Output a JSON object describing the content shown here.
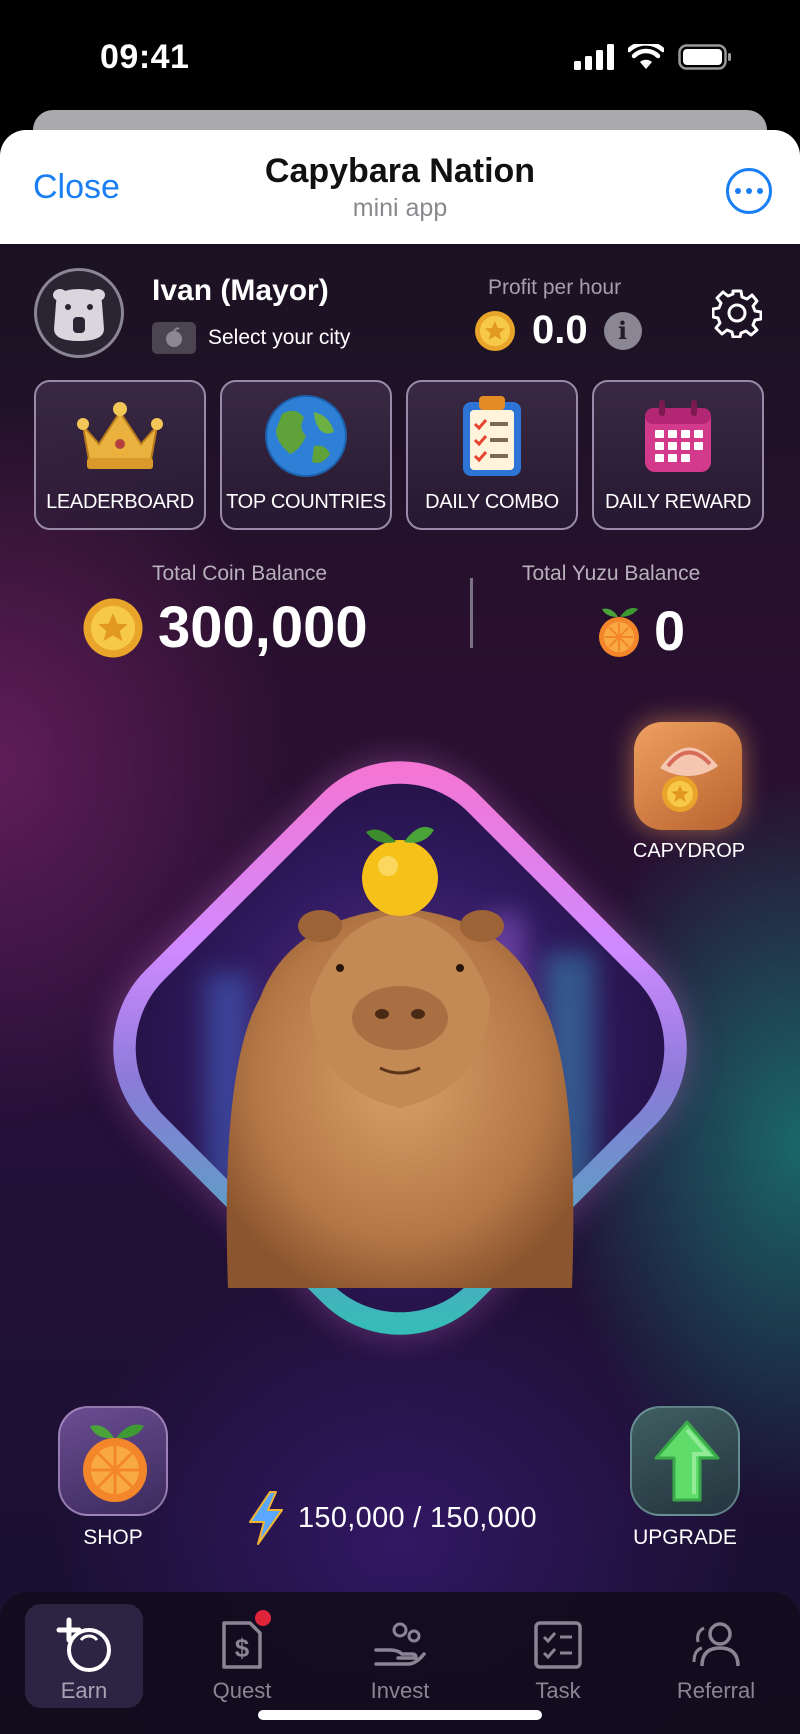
{
  "status_bar": {
    "time": "09:41"
  },
  "header": {
    "close_label": "Close",
    "title": "Capybara Nation",
    "subtitle": "mini app"
  },
  "profile": {
    "name": "Ivan  (Mayor)",
    "city_prompt": "Select your city"
  },
  "profit": {
    "label": "Profit per hour",
    "value": "0.0"
  },
  "tiles": [
    {
      "label": "LEADERBOARD",
      "icon": "crown-icon"
    },
    {
      "label": "TOP COUNTRIES",
      "icon": "globe-icon"
    },
    {
      "label": "DAILY COMBO",
      "icon": "clipboard-icon"
    },
    {
      "label": "DAILY REWARD",
      "icon": "calendar-icon"
    }
  ],
  "balances": {
    "coin_label": "Total Coin Balance",
    "coin_value": "300,000",
    "yuzu_label": "Total Yuzu Balance",
    "yuzu_value": "0"
  },
  "capydrop": {
    "label": "CAPYDROP"
  },
  "actions": {
    "shop_label": "SHOP",
    "upgrade_label": "UPGRADE"
  },
  "energy": {
    "value": "150,000 / 150,000"
  },
  "nav": [
    {
      "label": "Earn",
      "icon": "earn-coin-icon",
      "active": true
    },
    {
      "label": "Quest",
      "icon": "quest-dollar-doc-icon",
      "badge": true
    },
    {
      "label": "Invest",
      "icon": "invest-hand-icon"
    },
    {
      "label": "Task",
      "icon": "task-checklist-icon"
    },
    {
      "label": "Referral",
      "icon": "referral-people-icon"
    }
  ],
  "colors": {
    "accent_blue": "#1a7ef5",
    "coin_gold": "#f2b533",
    "badge_red": "#e0243a"
  }
}
